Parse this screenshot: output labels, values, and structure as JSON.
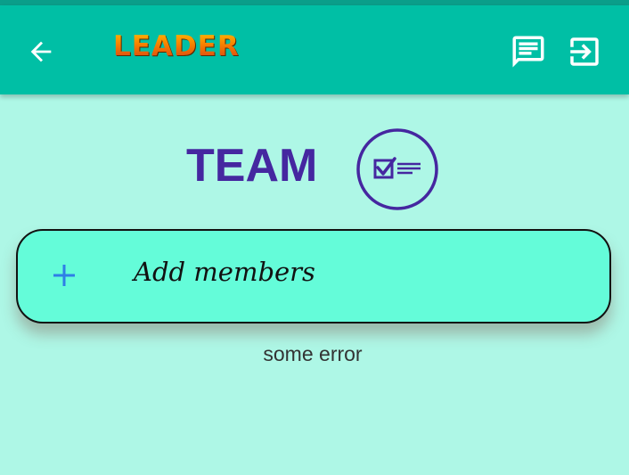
{
  "app_bar": {
    "title": "LEADER",
    "back_icon": "arrow-left-icon",
    "chat_icon": "chat-message-icon",
    "logout_icon": "logout-icon",
    "background": "#00bfa5"
  },
  "main": {
    "heading": "TEAM",
    "logo_icon": "checklist-circle-icon",
    "add_members": {
      "icon": "plus-icon",
      "label": "Add members"
    },
    "error_text": "some error"
  },
  "colors": {
    "page_background": "#aef7e6",
    "card_background": "#64fcd9",
    "heading": "#4527a0",
    "plus": "#2e7ee6"
  }
}
